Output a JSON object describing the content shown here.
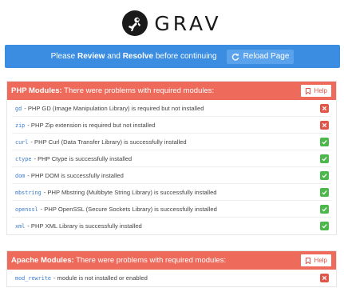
{
  "brand": {
    "name": "GRAV",
    "logo_icon": "grav-astronaut-icon"
  },
  "notice": {
    "prefix": "Please ",
    "review": "Review",
    "middle": " and ",
    "resolve": "Resolve",
    "suffix": " before continuing",
    "reload_label": "Reload Page",
    "reload_icon": "reload-icon",
    "color": "#3a8de0"
  },
  "php_modules": {
    "title_bold": "PHP Modules:",
    "title_rest": " There were problems with required modules:",
    "help_label": "Help",
    "header_color": "#ee6b5c",
    "items": [
      {
        "code": "gd",
        "text": "- PHP GD (Image Manipulation Library) is required but not installed",
        "status": "fail"
      },
      {
        "code": "zip",
        "text": "- PHP Zip extension is required but not installed",
        "status": "fail"
      },
      {
        "code": "curl",
        "text": "- PHP Curl (Data Transfer Library) is successfully installed",
        "status": "ok"
      },
      {
        "code": "ctype",
        "text": "- PHP Ctype is successfully installed",
        "status": "ok"
      },
      {
        "code": "dom",
        "text": "- PHP DOM is successfully installed",
        "status": "ok"
      },
      {
        "code": "mbstring",
        "text": "- PHP Mbstring (Multibyte String Library) is successfully installed",
        "status": "ok"
      },
      {
        "code": "openssl",
        "text": "- PHP OpenSSL (Secure Sockets Library) is successfully installed",
        "status": "ok"
      },
      {
        "code": "xml",
        "text": "- PHP XML Library is successfully installed",
        "status": "ok"
      }
    ]
  },
  "apache_modules": {
    "title_bold": "Apache Modules:",
    "title_rest": " There were problems with required modules:",
    "help_label": "Help",
    "header_color": "#ee6b5c",
    "items": [
      {
        "code": "mod_rewrite",
        "text": "- module is not installed or enabled",
        "status": "fail"
      }
    ]
  },
  "status_colors": {
    "fail": "#e0574a",
    "ok": "#4cb84c"
  }
}
